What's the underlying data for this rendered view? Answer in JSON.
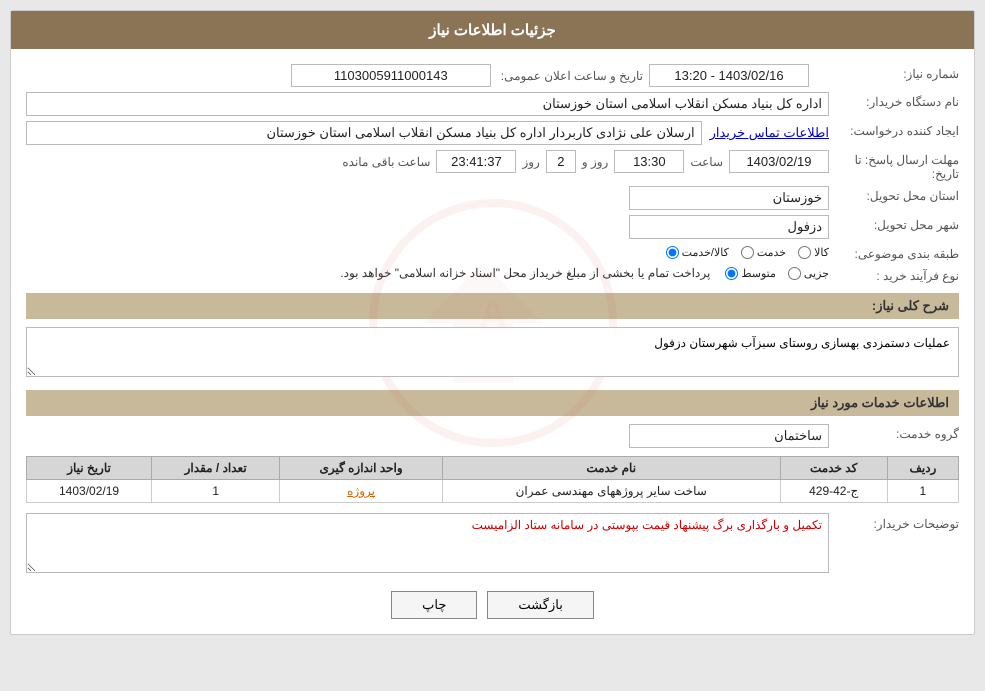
{
  "header": {
    "title": "جزئیات اطلاعات نیاز"
  },
  "labels": {
    "need_number": "شماره نیاز:",
    "buyer_org": "نام دستگاه خریدار:",
    "creator": "ایجاد کننده درخواست:",
    "send_deadline": "مهلت ارسال پاسخ: تا تاریخ:",
    "delivery_province": "استان محل تحویل:",
    "delivery_city": "شهر محل تحویل:",
    "category": "طبقه بندی موضوعی:",
    "process_type": "نوع فرآیند خرید :",
    "need_description": "شرح کلی نیاز:",
    "services_info": "اطلاعات خدمات مورد نیاز",
    "service_group": "گروه خدمت:",
    "buyer_notes": "توضیحات خریدار:"
  },
  "values": {
    "need_number": "1103005911000143",
    "announce_datetime": "1403/02/16 - 13:20",
    "announce_label": "تاریخ و ساعت اعلان عمومی:",
    "buyer_org": "اداره کل بنیاد مسکن انقلاب اسلامی استان خوزستان",
    "creator": "ارسلان علی نژادی کاربردار اداره کل بنیاد مسکن انقلاب اسلامی استان خوزستان",
    "contact_link": "اطلاعات تماس خریدار",
    "deadline_date": "1403/02/19",
    "deadline_time": "13:30",
    "deadline_days": "2",
    "deadline_remaining": "23:41:37",
    "deadline_days_label": "روز و",
    "deadline_remaining_label": "ساعت باقی مانده",
    "delivery_province": "خوزستان",
    "delivery_city": "دزفول",
    "category_radio": [
      "کالا",
      "خدمت",
      "کالا/خدمت"
    ],
    "category_selected": "کالا",
    "process_radio": [
      "جزیی",
      "متوسط"
    ],
    "process_note": "پرداخت تمام یا بخشی از مبلغ خریداز محل \"اسناد خزانه اسلامی\" خواهد بود.",
    "need_description_text": "عملیات دستمزدی بهسازی روستای سبزآب شهرستان دزفول",
    "service_group_value": "ساختمان",
    "table_headers": [
      "ردیف",
      "کد خدمت",
      "نام خدمت",
      "واحد اندازه گیری",
      "تعداد / مقدار",
      "تاریخ نیاز"
    ],
    "table_rows": [
      {
        "row": "1",
        "code": "ج-42-429",
        "name": "ساخت سایر پروژههای مهندسی عمران",
        "unit": "پروژه",
        "count": "1",
        "date": "1403/02/19"
      }
    ],
    "buyer_notes_text": "تکمیل و بارگذاری برگ پیشنهاد قیمت بپوستی در سامانه ستاد الزامیست",
    "btn_print": "چاپ",
    "btn_back": "بازگشت"
  }
}
